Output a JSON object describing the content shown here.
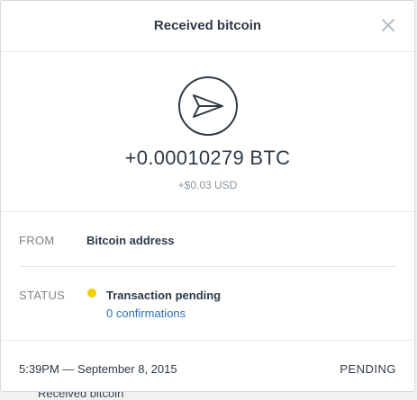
{
  "modal": {
    "title": "Received bitcoin",
    "close_icon": "close-icon"
  },
  "transaction": {
    "icon": "paper-plane-icon",
    "amount_btc": "+0.00010279 BTC",
    "amount_fiat": "+$0.03 USD"
  },
  "details": {
    "from_label": "FROM",
    "from_value": "Bitcoin address",
    "status_label": "STATUS",
    "status_value": "Transaction pending",
    "status_color": "#f2cf00",
    "confirmations": "0 confirmations"
  },
  "footer": {
    "timestamp": "5:39PM — September 8, 2015",
    "status": "PENDING"
  },
  "background": {
    "partial_text": "Received bitcoin"
  },
  "colors": {
    "link": "#2a72b5",
    "text": "#2f3a45",
    "muted": "#7b858e"
  }
}
